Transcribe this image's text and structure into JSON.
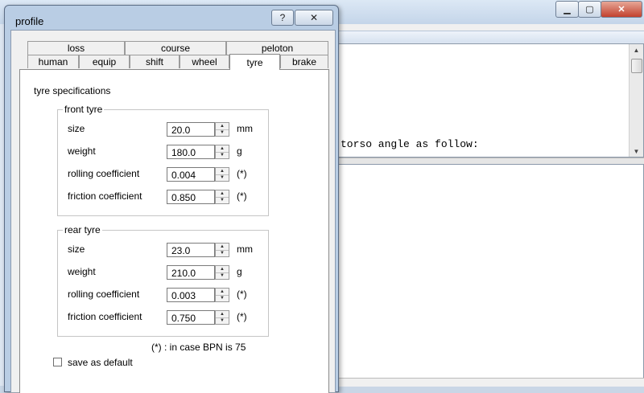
{
  "background_window": {
    "title": "",
    "content_text": "torso angle as follow:"
  },
  "dialog": {
    "title": "profile",
    "help_label": "?",
    "close_label": "✕"
  },
  "tabs": {
    "row1": [
      "loss",
      "course",
      "peloton"
    ],
    "row2": [
      "human",
      "equip",
      "shift",
      "wheel",
      "tyre",
      "brake"
    ],
    "active": "tyre"
  },
  "panel": {
    "title": "tyre specifications",
    "front": {
      "legend": "front tyre",
      "rows": [
        {
          "label": "size",
          "value": "20.0",
          "unit": "mm"
        },
        {
          "label": "weight",
          "value": "180.0",
          "unit": "g"
        },
        {
          "label": "rolling coefficient",
          "value": "0.004",
          "unit": "(*)"
        },
        {
          "label": "friction coefficient",
          "value": "0.850",
          "unit": "(*)"
        }
      ]
    },
    "rear": {
      "legend": "rear tyre",
      "rows": [
        {
          "label": "size",
          "value": "23.0",
          "unit": "mm"
        },
        {
          "label": "weight",
          "value": "210.0",
          "unit": "g"
        },
        {
          "label": "rolling coefficient",
          "value": "0.003",
          "unit": "(*)"
        },
        {
          "label": "friction coefficient",
          "value": "0.750",
          "unit": "(*)"
        }
      ]
    },
    "note": "(*) : in case BPN is 75",
    "save_default_label": "save as default",
    "save_default_checked": false
  },
  "icons": {
    "spin_up": "spin-up-arrow-icon",
    "spin_down": "spin-down-arrow-icon",
    "minimize": "minimize-icon",
    "maximize": "maximize-icon",
    "close": "close-icon"
  },
  "colors": {
    "dialog_frame": "#b9cde4",
    "client_bg": "#f0f0f0",
    "panel_bg": "#ffffff",
    "close_red": "#c2412e"
  }
}
